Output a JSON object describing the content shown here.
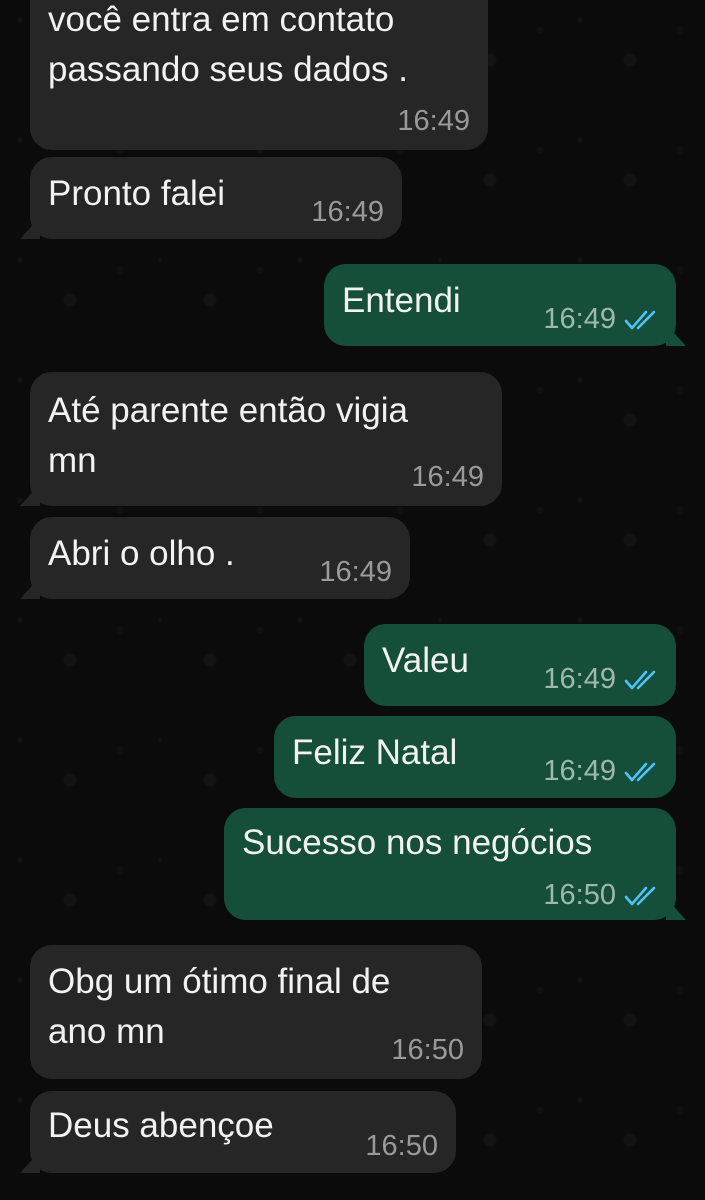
{
  "colors": {
    "background": "#0b0b0b",
    "incoming_bubble": "#262626",
    "outgoing_bubble": "#154f3a",
    "text": "#f2f2f2",
    "incoming_time": "#9a9a9a",
    "read_ticks": "#4fc3f7"
  },
  "messages": [
    {
      "id": "m1",
      "direction": "in",
      "lines": [
        "você entra em contato",
        "passando seus dados ."
      ],
      "time": "16:49"
    },
    {
      "id": "m2",
      "direction": "in",
      "lines": [
        "Pronto falei"
      ],
      "time": "16:49"
    },
    {
      "id": "m3",
      "direction": "out",
      "lines": [
        "Entendi"
      ],
      "time": "16:49",
      "status": "read",
      "status_icon": "double-check-icon"
    },
    {
      "id": "m4",
      "direction": "in",
      "lines": [
        "Até parente então vigia",
        "mn"
      ],
      "time": "16:49"
    },
    {
      "id": "m5",
      "direction": "in",
      "lines": [
        "Abri o olho ."
      ],
      "time": "16:49"
    },
    {
      "id": "m6",
      "direction": "out",
      "lines": [
        "Valeu"
      ],
      "time": "16:49",
      "status": "read",
      "status_icon": "double-check-icon"
    },
    {
      "id": "m7",
      "direction": "out",
      "lines": [
        "Feliz Natal"
      ],
      "time": "16:49",
      "status": "read",
      "status_icon": "double-check-icon"
    },
    {
      "id": "m8",
      "direction": "out",
      "lines": [
        "Sucesso nos negócios"
      ],
      "time": "16:50",
      "status": "read",
      "status_icon": "double-check-icon"
    },
    {
      "id": "m9",
      "direction": "in",
      "lines": [
        "Obg um ótimo final de",
        "ano mn"
      ],
      "time": "16:50"
    },
    {
      "id": "m10",
      "direction": "in",
      "lines": [
        "Deus abençoe"
      ],
      "time": "16:50"
    }
  ]
}
